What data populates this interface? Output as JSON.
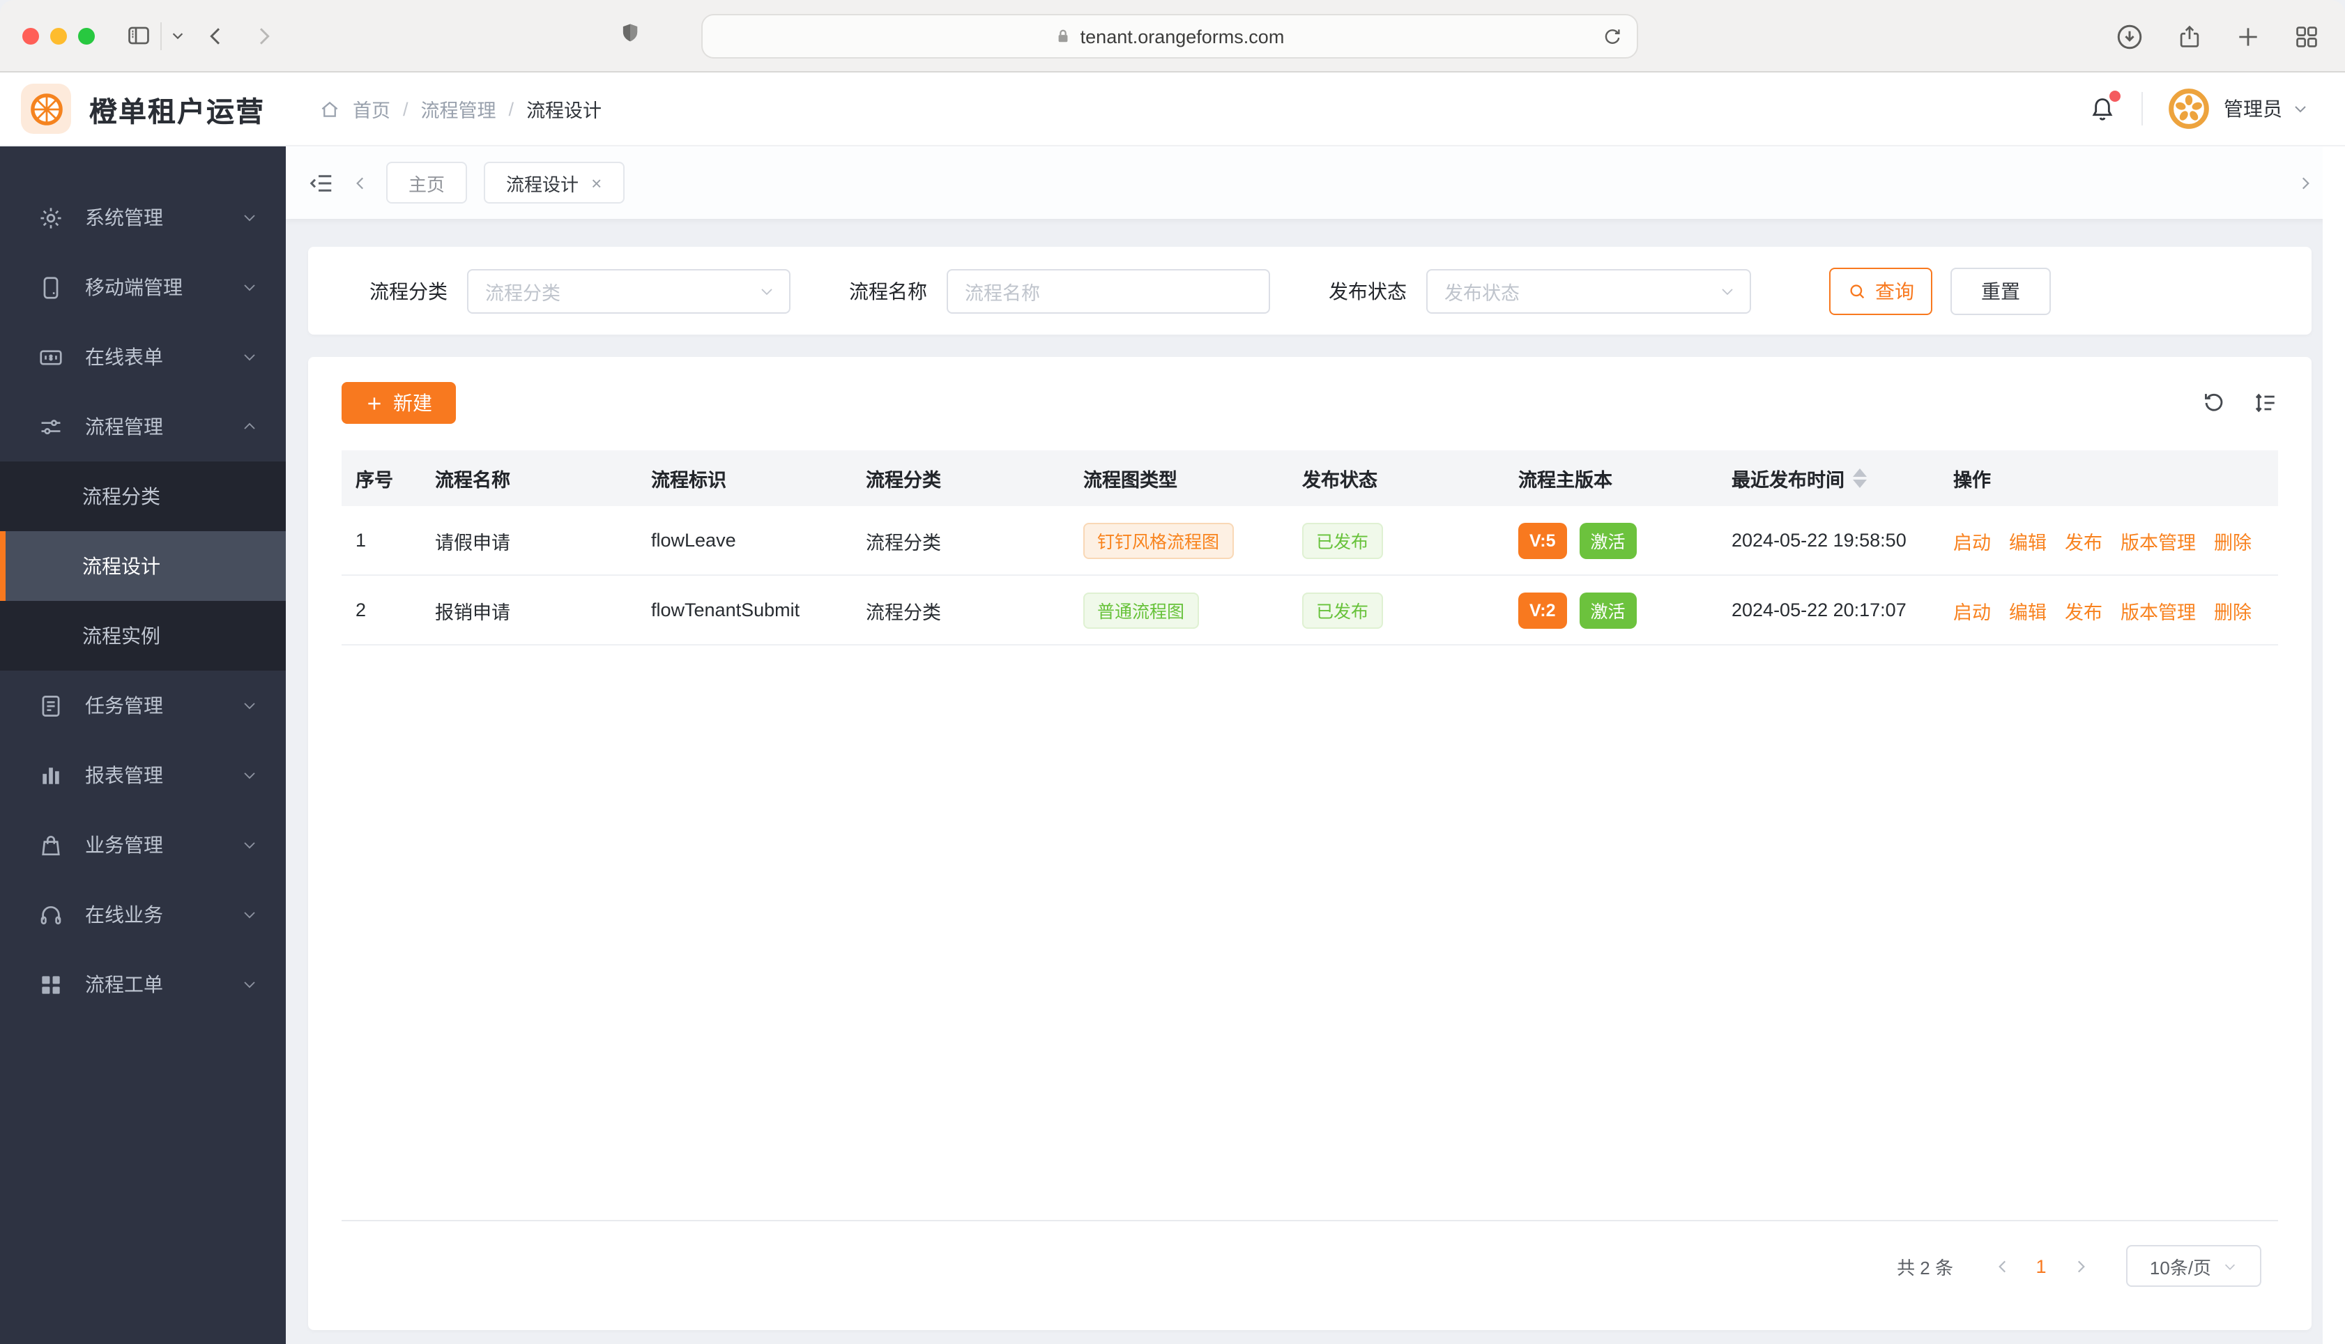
{
  "browser": {
    "url": "tenant.orangeforms.com"
  },
  "header": {
    "app_title": "橙单租户运营",
    "breadcrumb_items": [
      "首页",
      "流程管理",
      "流程设计"
    ],
    "user_name": "管理员"
  },
  "sidebar": {
    "items": [
      {
        "label": "系统管理",
        "icon": "gear-icon"
      },
      {
        "label": "移动端管理",
        "icon": "mobile-icon"
      },
      {
        "label": "在线表单",
        "icon": "form-icon"
      },
      {
        "label": "流程管理",
        "icon": "sliders-icon",
        "expanded": true,
        "children": [
          {
            "label": "流程分类",
            "active": false
          },
          {
            "label": "流程设计",
            "active": true
          },
          {
            "label": "流程实例",
            "active": false
          }
        ]
      },
      {
        "label": "任务管理",
        "icon": "document-icon"
      },
      {
        "label": "报表管理",
        "icon": "bar-chart-icon"
      },
      {
        "label": "业务管理",
        "icon": "bag-icon"
      },
      {
        "label": "在线业务",
        "icon": "headset-icon"
      },
      {
        "label": "流程工单",
        "icon": "grid-icon"
      }
    ]
  },
  "tabs": {
    "items": [
      {
        "label": "主页",
        "active": false,
        "closable": false
      },
      {
        "label": "流程设计",
        "active": true,
        "closable": true
      }
    ]
  },
  "filters": {
    "category_label": "流程分类",
    "category_placeholder": "流程分类",
    "name_label": "流程名称",
    "name_placeholder": "流程名称",
    "status_label": "发布状态",
    "status_placeholder": "发布状态",
    "search_button": "查询",
    "reset_button": "重置"
  },
  "toolbar": {
    "create_button": "新建"
  },
  "table": {
    "columns": [
      "序号",
      "流程名称",
      "流程标识",
      "流程分类",
      "流程图类型",
      "发布状态",
      "流程主版本",
      "最近发布时间",
      "操作"
    ],
    "actions": [
      "启动",
      "编辑",
      "发布",
      "版本管理",
      "删除"
    ],
    "rows": [
      {
        "index": "1",
        "name": "请假申请",
        "key": "flowLeave",
        "category": "流程分类",
        "diagram_type": "钉钉风格流程图",
        "diagram_style": "orange",
        "publish_status": "已发布",
        "version": "V:5",
        "active_status": "激活",
        "published_at": "2024-05-22 19:58:50"
      },
      {
        "index": "2",
        "name": "报销申请",
        "key": "flowTenantSubmit",
        "category": "流程分类",
        "diagram_type": "普通流程图",
        "diagram_style": "green",
        "publish_status": "已发布",
        "version": "V:2",
        "active_status": "激活",
        "published_at": "2024-05-22 20:17:07"
      }
    ]
  },
  "pagination": {
    "total_text": "共 2 条",
    "current_page": "1",
    "page_size": "10条/页"
  },
  "colors": {
    "primary_orange": "#f8791f",
    "success_green": "#67c23a",
    "sidebar_bg": "#2e3342",
    "page_bg": "#eef0f4"
  }
}
